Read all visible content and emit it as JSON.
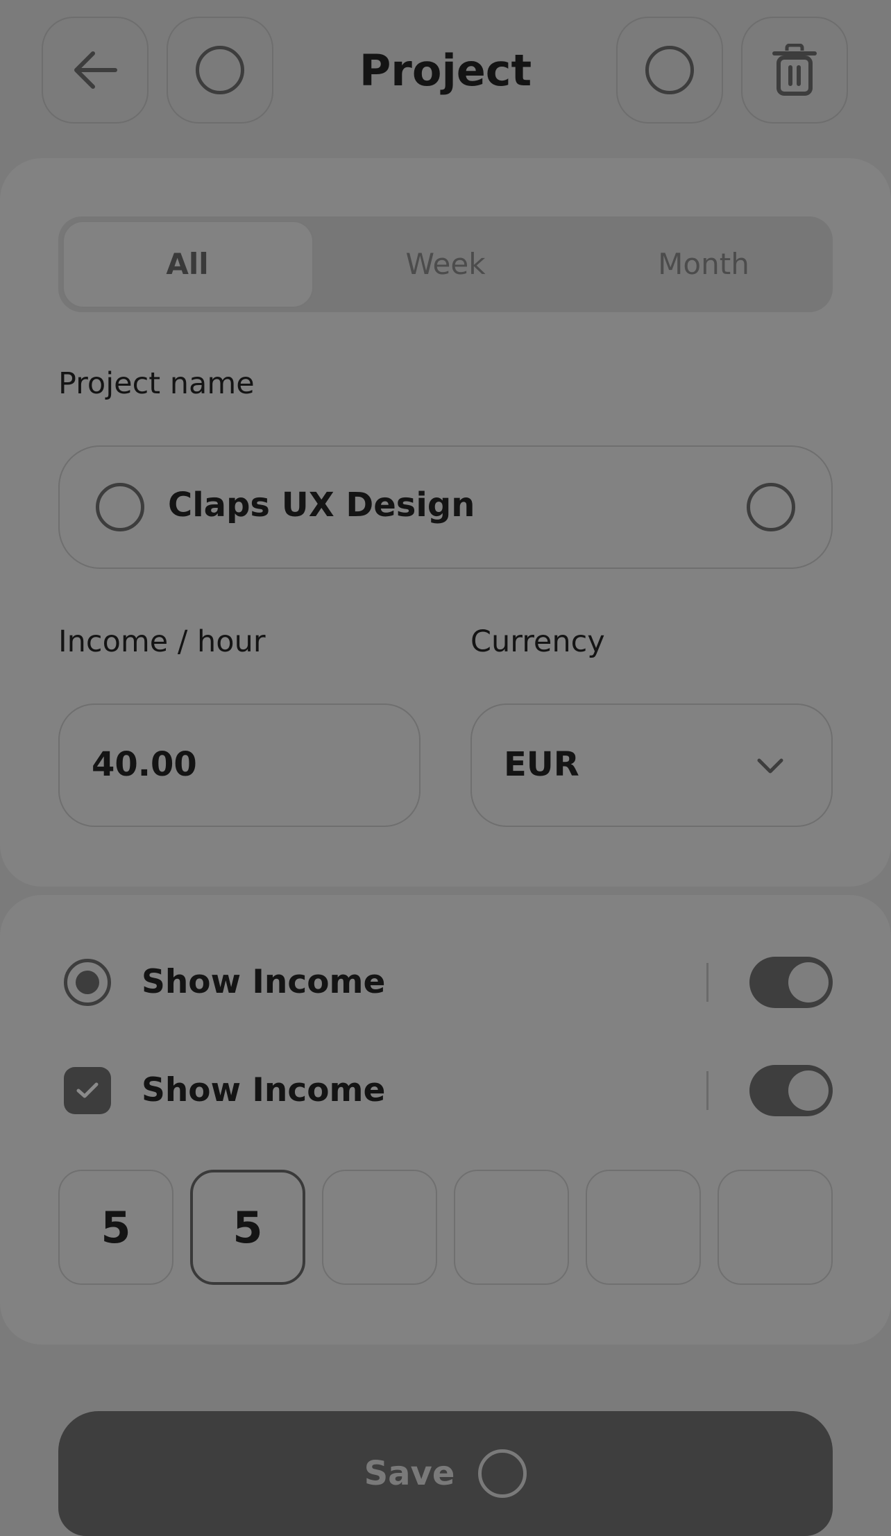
{
  "header": {
    "title": "Project",
    "back_icon": "arrow-left-icon",
    "delete_icon": "trash-icon"
  },
  "tabs": [
    {
      "label": "All",
      "active": true
    },
    {
      "label": "Week",
      "active": false
    },
    {
      "label": "Month",
      "active": false
    }
  ],
  "project_name": {
    "label": "Project name",
    "value": "Claps UX Design"
  },
  "income": {
    "label": "Income / hour",
    "value": "40.00"
  },
  "currency": {
    "label": "Currency",
    "value": "EUR"
  },
  "options": [
    {
      "label": "Show Income",
      "control": "radio",
      "checked": true,
      "toggle_on": true
    },
    {
      "label": "Show Income",
      "control": "checkbox",
      "checked": true,
      "toggle_on": true
    }
  ],
  "otp": [
    "5",
    "5",
    "",
    "",
    "",
    ""
  ],
  "save_label": "Save",
  "colors": {
    "overlay": "#7b7b7b",
    "card": "#828282",
    "dark": "#3e3e3e"
  }
}
